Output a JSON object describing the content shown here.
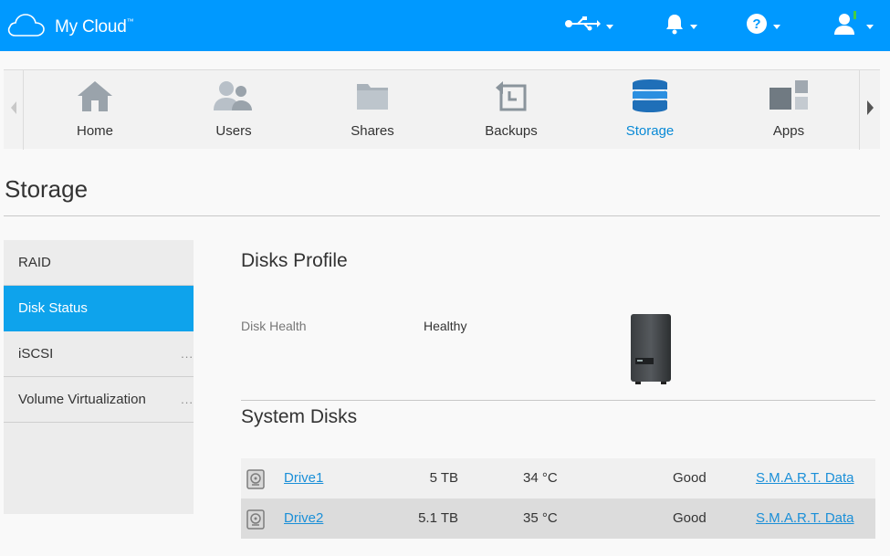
{
  "app": {
    "brand": "My Cloud",
    "trademark": "™"
  },
  "topbar": {
    "icons": [
      "usb-icon",
      "bell-icon",
      "help-icon",
      "user-icon"
    ]
  },
  "nav": {
    "items": [
      {
        "label": "Home",
        "icon": "home-icon"
      },
      {
        "label": "Users",
        "icon": "users-icon"
      },
      {
        "label": "Shares",
        "icon": "folder-icon"
      },
      {
        "label": "Backups",
        "icon": "backup-icon"
      },
      {
        "label": "Storage",
        "icon": "storage-icon",
        "active": true
      },
      {
        "label": "Apps",
        "icon": "apps-icon"
      }
    ]
  },
  "page": {
    "title": "Storage"
  },
  "sidebar": {
    "items": [
      {
        "label": "RAID"
      },
      {
        "label": "Disk Status",
        "active": true
      },
      {
        "label": "iSCSI",
        "more": "..."
      },
      {
        "label": "Volume Virtualization",
        "more": "..."
      }
    ]
  },
  "disks_profile": {
    "heading": "Disks Profile",
    "health_label": "Disk Health",
    "health_value": "Healthy"
  },
  "system_disks": {
    "heading": "System Disks",
    "rows": [
      {
        "name": "Drive1",
        "size": "5 TB",
        "temp": "34 °C",
        "status": "Good",
        "link": "S.M.A.R.T. Data"
      },
      {
        "name": "Drive2",
        "size": "5.1 TB",
        "temp": "35 °C",
        "status": "Good",
        "link": "S.M.A.R.T. Data"
      }
    ]
  },
  "colors": {
    "brand_blue": "#0099ff",
    "active_menu": "#0ea3ec",
    "link": "#1a8fd8"
  }
}
